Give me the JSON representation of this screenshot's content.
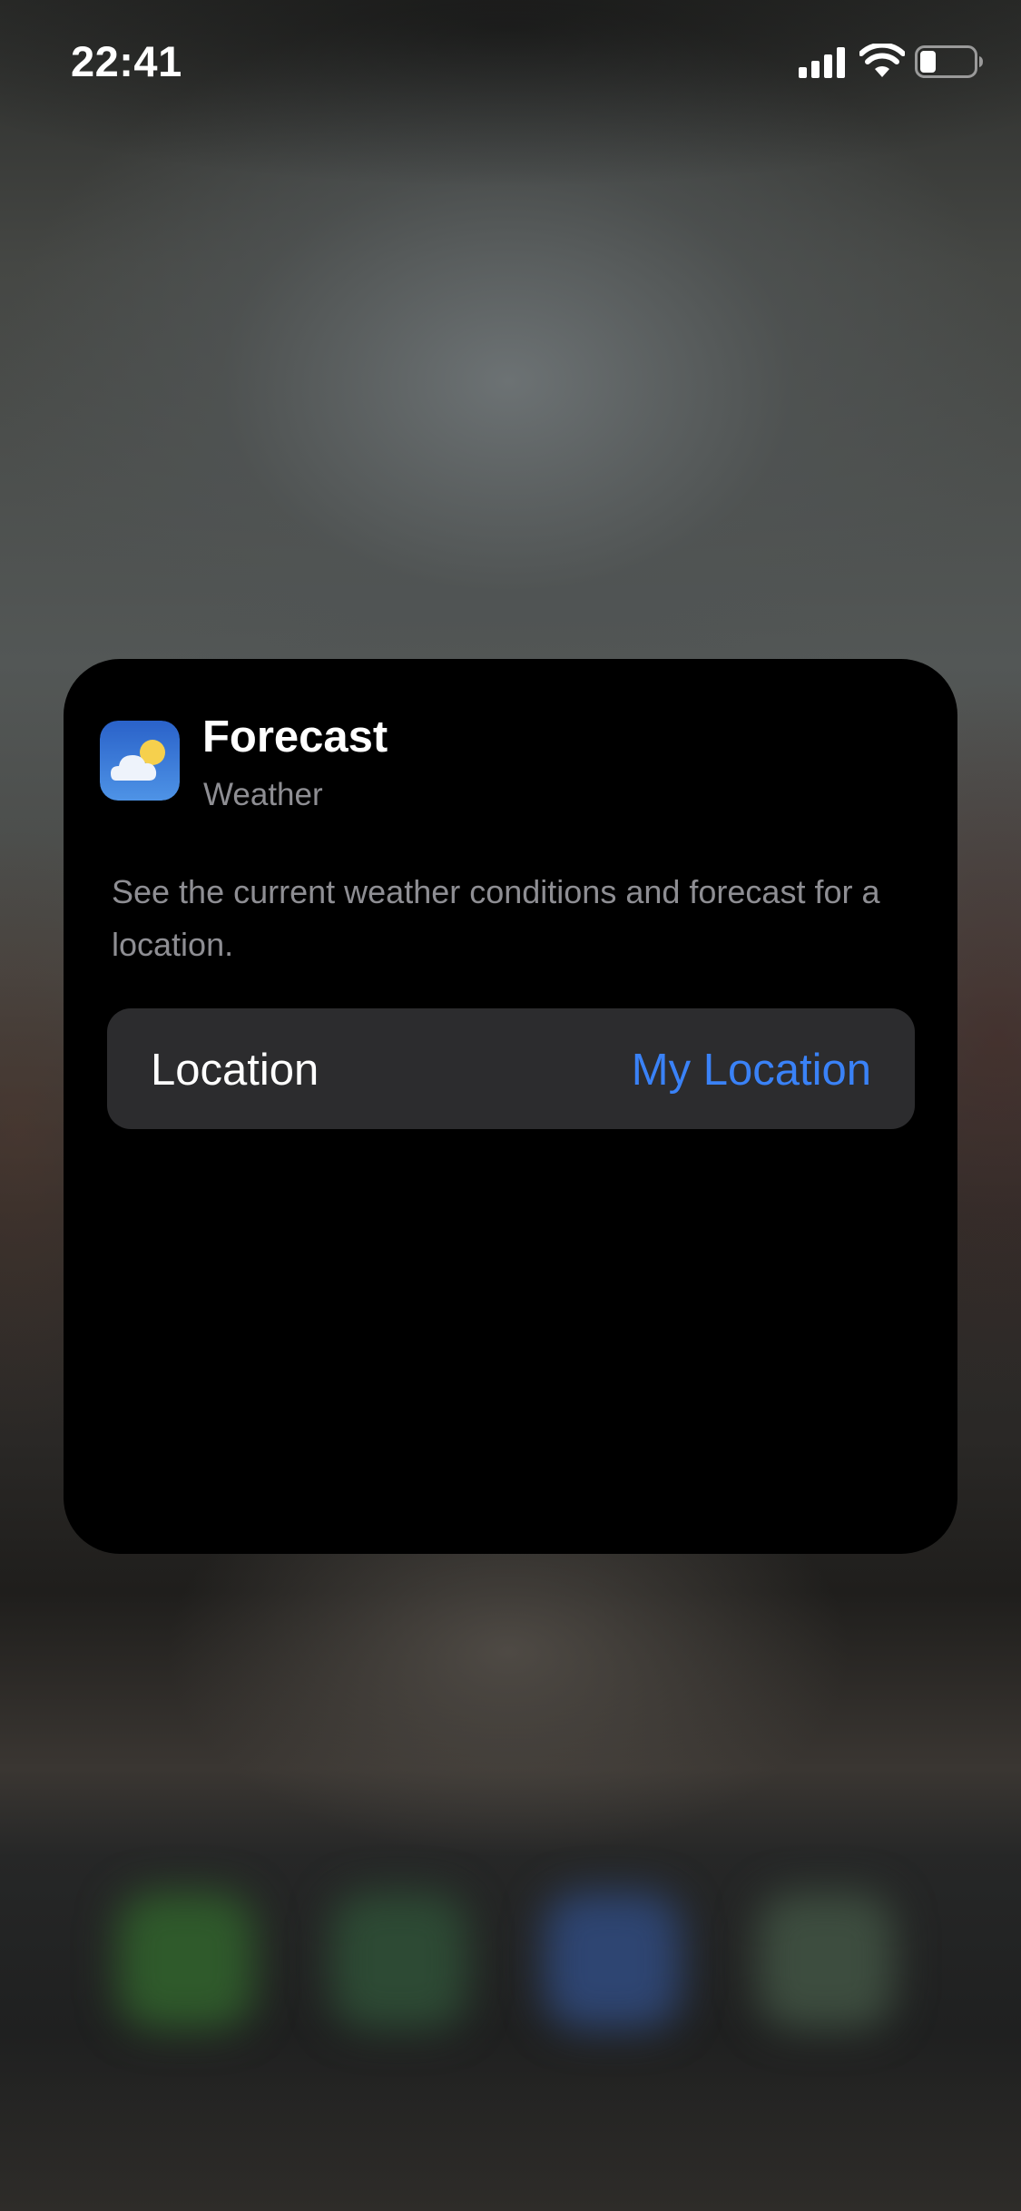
{
  "status_bar": {
    "time": "22:41",
    "signal_icon": "cellular-signal-icon",
    "wifi_icon": "wifi-icon",
    "battery_icon": "battery-icon",
    "battery_level": 0.3
  },
  "widget": {
    "icon": "weather-app-icon",
    "title": "Forecast",
    "subtitle": "Weather",
    "description": "See the current weather conditions and forecast for a location.",
    "location_row": {
      "label": "Location",
      "value": "My Location"
    }
  },
  "dock": {
    "icons": [
      "phone-icon",
      "messages-icon",
      "safari-icon",
      "app-icon"
    ]
  },
  "colors": {
    "accent": "#3a82f7",
    "card_background": "#000000",
    "row_background": "#2c2c2e",
    "secondary_text": "#8e8e93"
  }
}
